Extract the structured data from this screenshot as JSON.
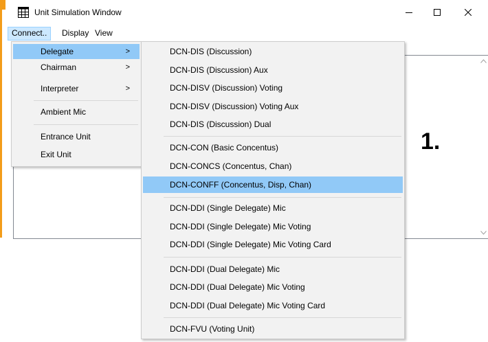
{
  "window": {
    "title": "Unit Simulation Window"
  },
  "menubar": {
    "items": [
      "Connect..",
      "Display",
      "View"
    ]
  },
  "connect_menu": {
    "items": [
      {
        "label": "Delegate",
        "submenu": true
      },
      {
        "label": "Chairman",
        "submenu": true
      },
      {
        "label": "Interpreter",
        "submenu": true
      },
      {
        "label": "Ambient Mic",
        "submenu": false
      },
      {
        "label": "Entrance Unit",
        "submenu": false
      },
      {
        "label": "Exit Unit",
        "submenu": false
      }
    ],
    "arrow": ">"
  },
  "delegate_submenu": {
    "items": [
      "DCN-DIS (Discussion)",
      "DCN-DIS (Discussion) Aux",
      "DCN-DISV (Discussion) Voting",
      "DCN-DISV (Discussion) Voting Aux",
      "DCN-DIS (Discussion) Dual",
      "DCN-CON (Basic Concentus)",
      "DCN-CONCS (Concentus, Chan)",
      "DCN-CONFF (Concentus, Disp, Chan)",
      "DCN-DDI (Single Delegate) Mic",
      "DCN-DDI (Single Delegate) Mic Voting",
      "DCN-DDI (Single Delegate) Mic Voting Card",
      "DCN-DDI (Dual Delegate) Mic",
      "DCN-DDI (Dual Delegate) Mic Voting",
      "DCN-DDI (Dual Delegate) Mic Voting Card",
      "DCN-FVU (Voting Unit)"
    ],
    "highlighted": "DCN-CONFF (Concentus, Disp, Chan)"
  },
  "annotation": {
    "label": "1."
  },
  "colors": {
    "highlight": "#91c9f7",
    "menu_bg": "#f2f2f2",
    "menubar_active": "#cce8ff",
    "accent_edge": "#f39c1a"
  },
  "icons": {
    "app": "grid-window-icon",
    "minimize": "minimize-icon",
    "maximize": "maximize-icon",
    "close": "close-icon",
    "submenu": "chevron-right-icon"
  }
}
